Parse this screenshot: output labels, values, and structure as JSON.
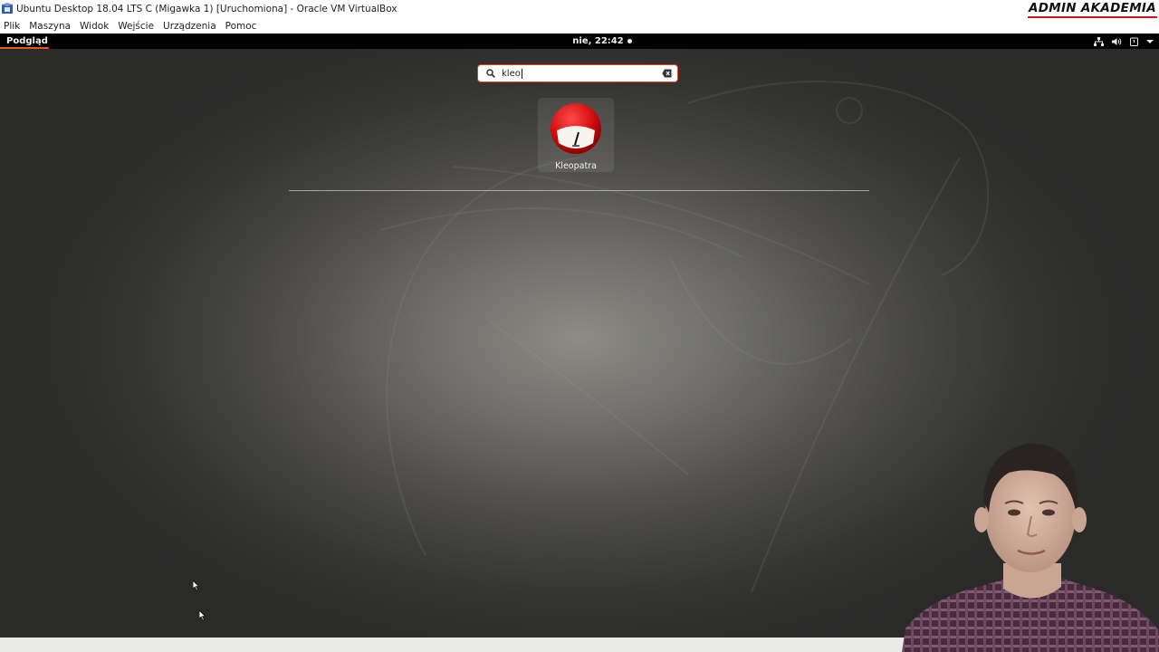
{
  "host_window": {
    "title": "Ubuntu Desktop 18.04 LTS C (Migawka 1) [Uruchomiona] - Oracle VM VirtualBox",
    "brand": "ADMIN AKADEMIA",
    "menu": [
      "Plik",
      "Maszyna",
      "Widok",
      "Wejście",
      "Urządzenia",
      "Pomoc"
    ]
  },
  "topbar": {
    "activities_label": "Podgląd",
    "clock": "nie, 22:42"
  },
  "search": {
    "value": "kleo"
  },
  "results": [
    {
      "label": "Kleopatra",
      "icon": "kleopatra-icon"
    }
  ],
  "colors": {
    "accent": "#e95420",
    "brand_underline": "#d0141b",
    "topbar_bg": "#000000",
    "search_border": "#e9401b"
  }
}
